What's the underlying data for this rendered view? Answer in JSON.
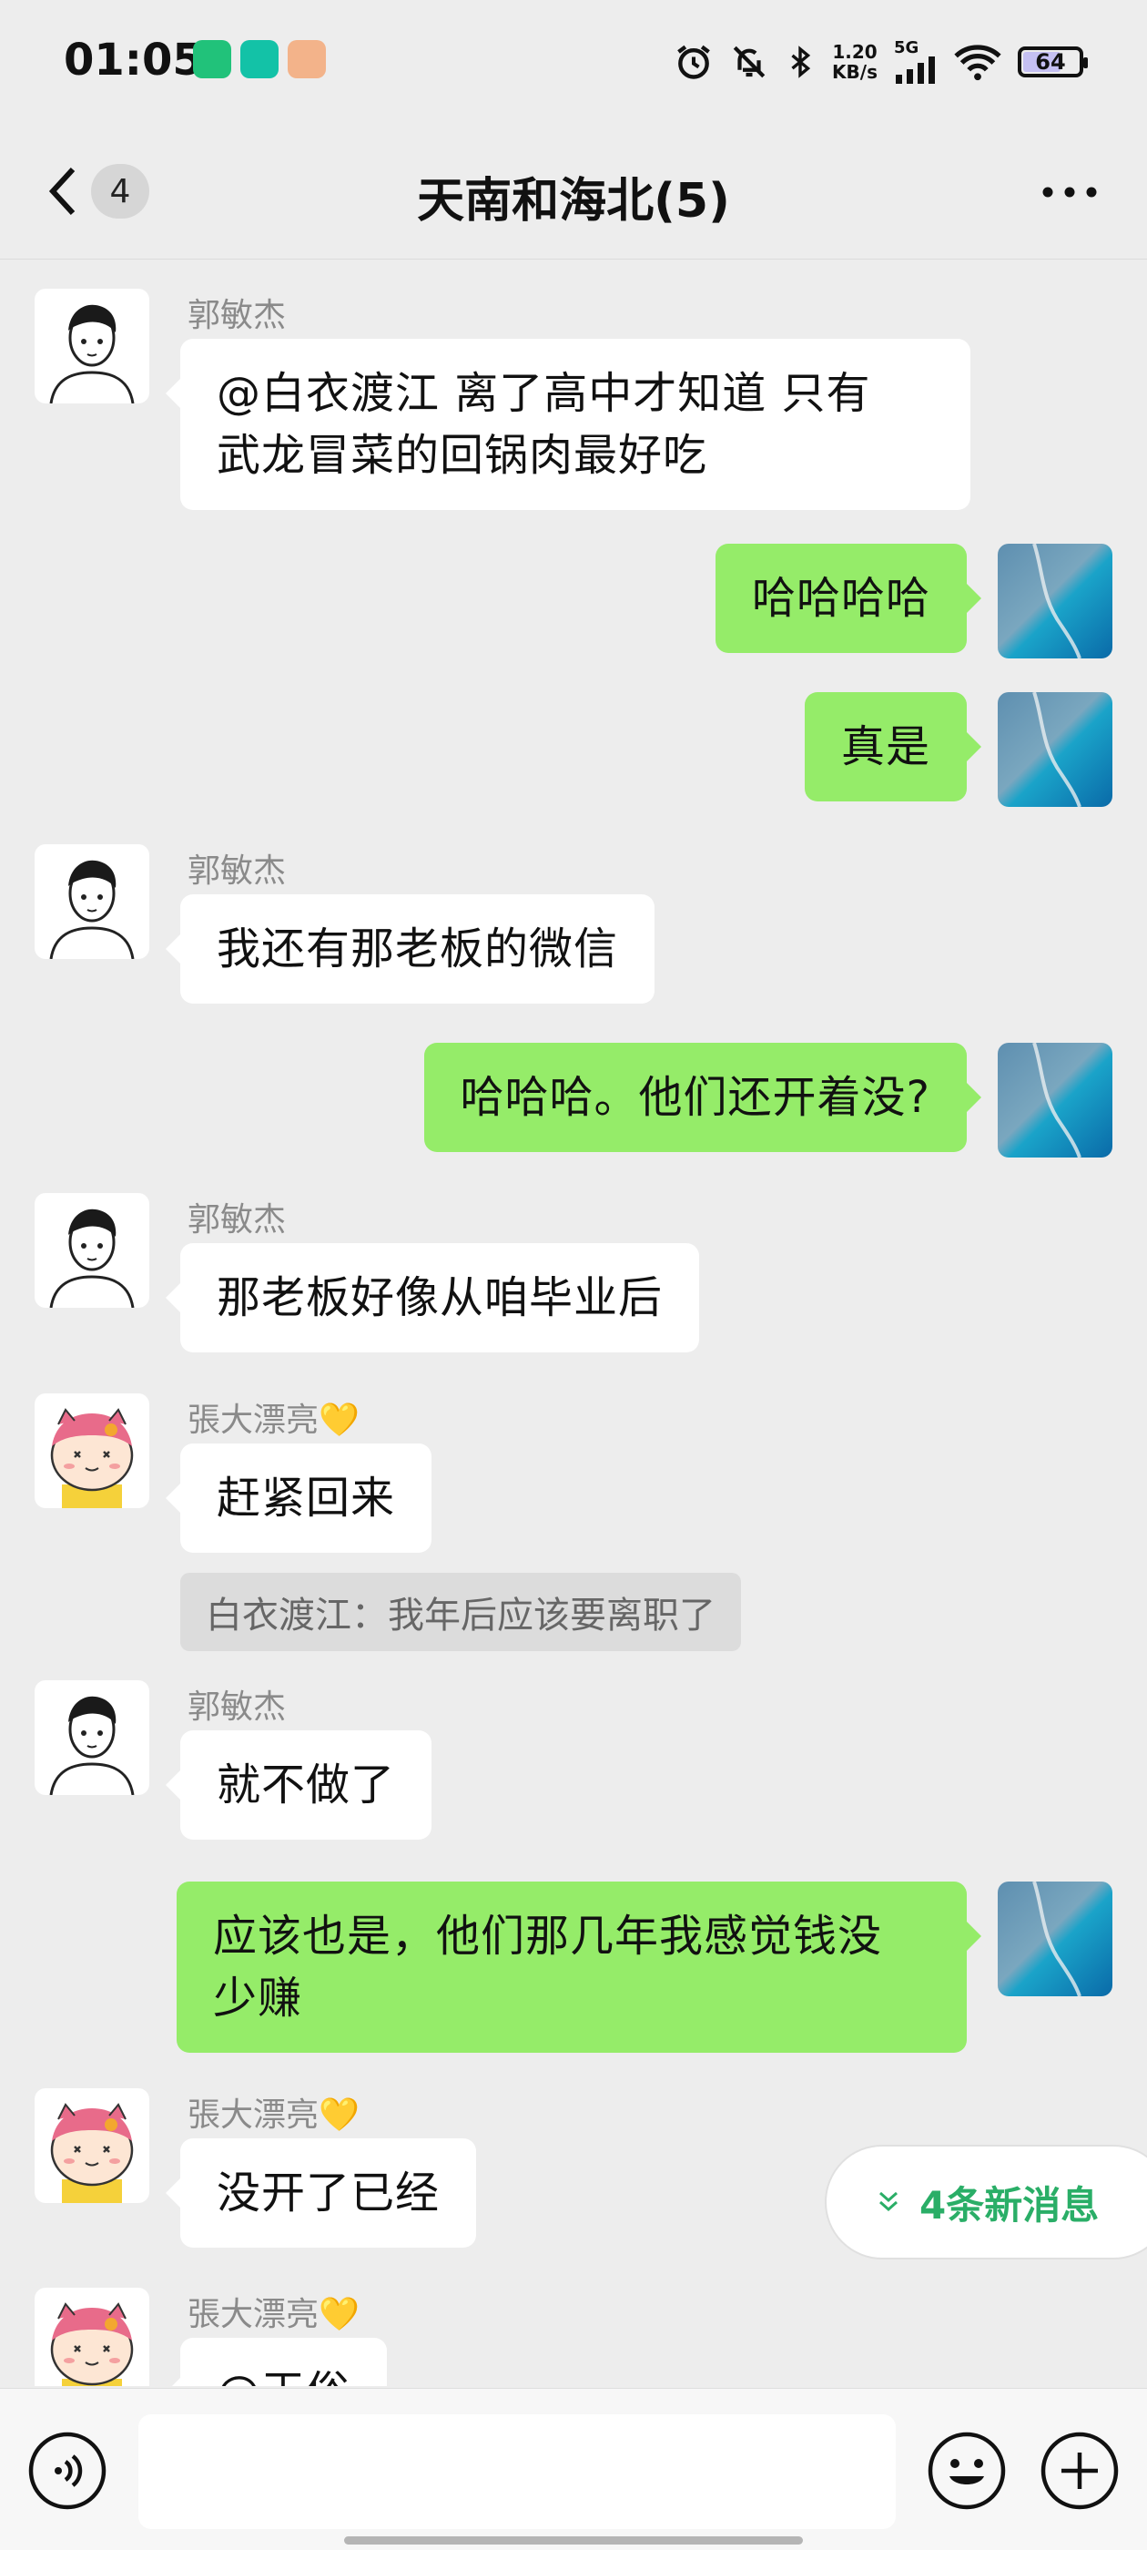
{
  "status_bar": {
    "time": "01:05",
    "speed_value": "1.20",
    "speed_unit": "KB/s",
    "network": "5G",
    "battery": "64",
    "battery_level": 64,
    "icons": [
      "mi-home-icon",
      "camera-app-icon",
      "tiger-app-icon",
      "alarm-icon",
      "mute-bell-icon",
      "bluetooth-icon",
      "signal-icon",
      "wifi-icon",
      "battery-icon"
    ]
  },
  "nav": {
    "back_icon": "chevron-left-icon",
    "unread_count": "4",
    "title": "天南和海北(5)",
    "more_icon": "more-horizontal-icon"
  },
  "messages": [
    {
      "side": "in",
      "sender": "郭敏杰",
      "avatar": "boy-avatar",
      "lines": [
        "@白衣渡江  离了高中才知道  只有",
        "武龙冒菜的回锅肉最好吃"
      ]
    },
    {
      "side": "out",
      "avatar": "ocean-avatar",
      "lines": [
        "哈哈哈哈"
      ]
    },
    {
      "side": "out",
      "avatar": "ocean-avatar",
      "lines": [
        "真是"
      ]
    },
    {
      "side": "in",
      "sender": "郭敏杰",
      "avatar": "boy-avatar",
      "lines": [
        "我还有那老板的微信"
      ]
    },
    {
      "side": "out",
      "avatar": "ocean-avatar",
      "lines": [
        "哈哈哈。他们还开着没?"
      ]
    },
    {
      "side": "in",
      "sender": "郭敏杰",
      "avatar": "boy-avatar",
      "lines": [
        "那老板好像从咱毕业后"
      ]
    },
    {
      "side": "in",
      "sender": "張大漂亮💛",
      "avatar": "cat-avatar",
      "lines": [
        "赶紧回来"
      ],
      "quote": "白衣渡江：我年后应该要离职了"
    },
    {
      "side": "in",
      "sender": "郭敏杰",
      "avatar": "boy-avatar",
      "lines": [
        "就不做了"
      ]
    },
    {
      "side": "out",
      "avatar": "ocean-avatar",
      "lines": [
        "应该也是，他们那几年我感觉钱没",
        "少赚"
      ]
    },
    {
      "side": "in",
      "sender": "張大漂亮💛",
      "avatar": "cat-avatar",
      "lines": [
        "没开了已经"
      ]
    },
    {
      "side": "in",
      "sender": "張大漂亮💛",
      "avatar": "cat-avatar",
      "lines": [
        "@王俗"
      ]
    }
  ],
  "new_messages": {
    "label": "4条新消息",
    "icon": "double-chevron-down-icon"
  },
  "input_bar": {
    "voice_icon": "voice-icon",
    "emoji_icon": "emoji-icon",
    "plus_icon": "plus-circle-icon",
    "value": ""
  },
  "colors": {
    "background": "#ededed",
    "outgoing_bubble": "#95ec69",
    "incoming_bubble": "#ffffff",
    "accent_green": "#2aae67"
  }
}
